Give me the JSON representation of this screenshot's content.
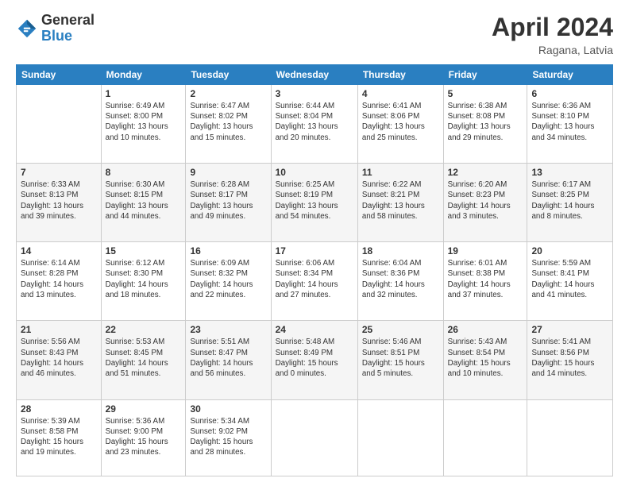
{
  "header": {
    "logo_general": "General",
    "logo_blue": "Blue",
    "title": "April 2024",
    "location": "Ragana, Latvia"
  },
  "weekdays": [
    "Sunday",
    "Monday",
    "Tuesday",
    "Wednesday",
    "Thursday",
    "Friday",
    "Saturday"
  ],
  "weeks": [
    [
      {
        "day": "",
        "info": ""
      },
      {
        "day": "1",
        "info": "Sunrise: 6:49 AM\nSunset: 8:00 PM\nDaylight: 13 hours\nand 10 minutes."
      },
      {
        "day": "2",
        "info": "Sunrise: 6:47 AM\nSunset: 8:02 PM\nDaylight: 13 hours\nand 15 minutes."
      },
      {
        "day": "3",
        "info": "Sunrise: 6:44 AM\nSunset: 8:04 PM\nDaylight: 13 hours\nand 20 minutes."
      },
      {
        "day": "4",
        "info": "Sunrise: 6:41 AM\nSunset: 8:06 PM\nDaylight: 13 hours\nand 25 minutes."
      },
      {
        "day": "5",
        "info": "Sunrise: 6:38 AM\nSunset: 8:08 PM\nDaylight: 13 hours\nand 29 minutes."
      },
      {
        "day": "6",
        "info": "Sunrise: 6:36 AM\nSunset: 8:10 PM\nDaylight: 13 hours\nand 34 minutes."
      }
    ],
    [
      {
        "day": "7",
        "info": "Sunrise: 6:33 AM\nSunset: 8:13 PM\nDaylight: 13 hours\nand 39 minutes."
      },
      {
        "day": "8",
        "info": "Sunrise: 6:30 AM\nSunset: 8:15 PM\nDaylight: 13 hours\nand 44 minutes."
      },
      {
        "day": "9",
        "info": "Sunrise: 6:28 AM\nSunset: 8:17 PM\nDaylight: 13 hours\nand 49 minutes."
      },
      {
        "day": "10",
        "info": "Sunrise: 6:25 AM\nSunset: 8:19 PM\nDaylight: 13 hours\nand 54 minutes."
      },
      {
        "day": "11",
        "info": "Sunrise: 6:22 AM\nSunset: 8:21 PM\nDaylight: 13 hours\nand 58 minutes."
      },
      {
        "day": "12",
        "info": "Sunrise: 6:20 AM\nSunset: 8:23 PM\nDaylight: 14 hours\nand 3 minutes."
      },
      {
        "day": "13",
        "info": "Sunrise: 6:17 AM\nSunset: 8:25 PM\nDaylight: 14 hours\nand 8 minutes."
      }
    ],
    [
      {
        "day": "14",
        "info": "Sunrise: 6:14 AM\nSunset: 8:28 PM\nDaylight: 14 hours\nand 13 minutes."
      },
      {
        "day": "15",
        "info": "Sunrise: 6:12 AM\nSunset: 8:30 PM\nDaylight: 14 hours\nand 18 minutes."
      },
      {
        "day": "16",
        "info": "Sunrise: 6:09 AM\nSunset: 8:32 PM\nDaylight: 14 hours\nand 22 minutes."
      },
      {
        "day": "17",
        "info": "Sunrise: 6:06 AM\nSunset: 8:34 PM\nDaylight: 14 hours\nand 27 minutes."
      },
      {
        "day": "18",
        "info": "Sunrise: 6:04 AM\nSunset: 8:36 PM\nDaylight: 14 hours\nand 32 minutes."
      },
      {
        "day": "19",
        "info": "Sunrise: 6:01 AM\nSunset: 8:38 PM\nDaylight: 14 hours\nand 37 minutes."
      },
      {
        "day": "20",
        "info": "Sunrise: 5:59 AM\nSunset: 8:41 PM\nDaylight: 14 hours\nand 41 minutes."
      }
    ],
    [
      {
        "day": "21",
        "info": "Sunrise: 5:56 AM\nSunset: 8:43 PM\nDaylight: 14 hours\nand 46 minutes."
      },
      {
        "day": "22",
        "info": "Sunrise: 5:53 AM\nSunset: 8:45 PM\nDaylight: 14 hours\nand 51 minutes."
      },
      {
        "day": "23",
        "info": "Sunrise: 5:51 AM\nSunset: 8:47 PM\nDaylight: 14 hours\nand 56 minutes."
      },
      {
        "day": "24",
        "info": "Sunrise: 5:48 AM\nSunset: 8:49 PM\nDaylight: 15 hours\nand 0 minutes."
      },
      {
        "day": "25",
        "info": "Sunrise: 5:46 AM\nSunset: 8:51 PM\nDaylight: 15 hours\nand 5 minutes."
      },
      {
        "day": "26",
        "info": "Sunrise: 5:43 AM\nSunset: 8:54 PM\nDaylight: 15 hours\nand 10 minutes."
      },
      {
        "day": "27",
        "info": "Sunrise: 5:41 AM\nSunset: 8:56 PM\nDaylight: 15 hours\nand 14 minutes."
      }
    ],
    [
      {
        "day": "28",
        "info": "Sunrise: 5:39 AM\nSunset: 8:58 PM\nDaylight: 15 hours\nand 19 minutes."
      },
      {
        "day": "29",
        "info": "Sunrise: 5:36 AM\nSunset: 9:00 PM\nDaylight: 15 hours\nand 23 minutes."
      },
      {
        "day": "30",
        "info": "Sunrise: 5:34 AM\nSunset: 9:02 PM\nDaylight: 15 hours\nand 28 minutes."
      },
      {
        "day": "",
        "info": ""
      },
      {
        "day": "",
        "info": ""
      },
      {
        "day": "",
        "info": ""
      },
      {
        "day": "",
        "info": ""
      }
    ]
  ]
}
